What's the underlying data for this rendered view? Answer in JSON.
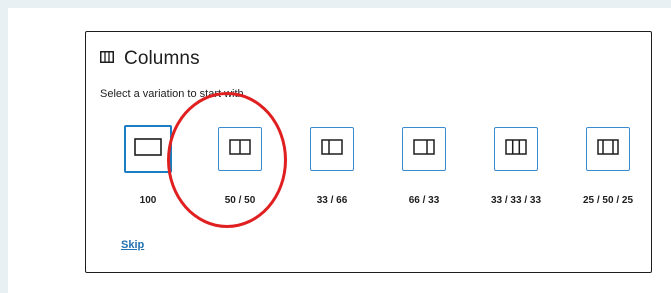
{
  "block": {
    "icon": "columns-icon",
    "title": "Columns",
    "instructions": "Select a variation to start with."
  },
  "variations": [
    {
      "label": "100",
      "icon": "single-column-icon"
    },
    {
      "label": "50 / 50",
      "icon": "two-columns-icon"
    },
    {
      "label": "33 / 66",
      "icon": "two-columns-left-narrow-icon"
    },
    {
      "label": "66 / 33",
      "icon": "two-columns-right-narrow-icon"
    },
    {
      "label": "33 / 33 / 33",
      "icon": "three-columns-icon"
    },
    {
      "label": "25 / 50 / 25",
      "icon": "three-columns-wide-center-icon"
    }
  ],
  "skip_label": "Skip",
  "colors": {
    "accent": "#3a8ccf",
    "annotation": "#e02020",
    "link": "#2271b1"
  }
}
